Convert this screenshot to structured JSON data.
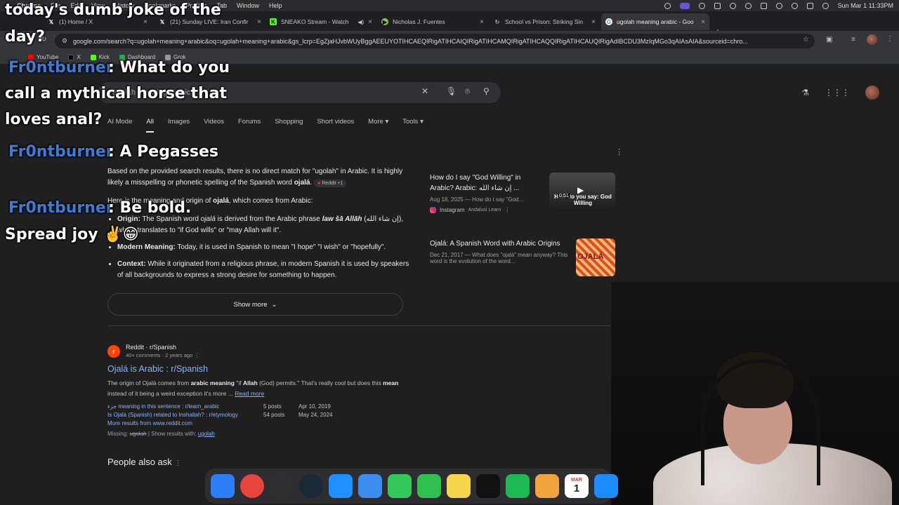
{
  "menubar": {
    "items": [
      "Chrome",
      "File",
      "Edit",
      "View",
      "History",
      "Bookmarks",
      "Profiles",
      "Tab",
      "Window",
      "Help"
    ],
    "clock": "Sun Mar 1  11:33PM"
  },
  "tabs": [
    {
      "title": "(1) Home / X",
      "icon": "x-logo-icon",
      "color": "#000000"
    },
    {
      "title": "(21) Sunday LIVE: Iran Confir",
      "icon": "x-logo-icon",
      "color": "#000000"
    },
    {
      "title": "SNEAKO Stream - Watch",
      "icon": "kick-logo-icon",
      "color": "#53fc18"
    },
    {
      "title": "Nicholas J. Fuentes",
      "icon": "rumble-logo-icon",
      "color": "#85c742"
    },
    {
      "title": "School vs Prison: Striking Sin",
      "icon": "refresh-icon",
      "color": "#aaaaaa"
    },
    {
      "title": "ugolah meaning arabic - Goo",
      "icon": "google-icon",
      "color": "#dddddd"
    }
  ],
  "address_url": "google.com/search?q=ugolah+meaning+arabic&oq=ugolah+meaning+arabic&gs_lcrp=EgZjaHJvbWUyBggAEEUYOTIHCAEQIRigATIHCAIQIRigATIHCAMQIRigATIHCAQQIRigATIHCAUQIRigAdIBCDU3MzIqMGo3qAIAsAIA&sourceid=chro...",
  "bookmarks": [
    {
      "label": "YouTube",
      "color": "#ff0000"
    },
    {
      "label": "X",
      "color": "#000000"
    },
    {
      "label": "Kick",
      "color": "#53fc18"
    },
    {
      "label": "Dashboard",
      "color": "#2da44e"
    },
    {
      "label": "Grok",
      "color": "#999999"
    }
  ],
  "search": {
    "query": "ugolah meaning arabic",
    "clear_icon": "close-icon",
    "mic_icon": "mic-icon",
    "lens_icon": "camera-icon",
    "search_icon": "search-icon"
  },
  "result_tabs": [
    "AI Mode",
    "All",
    "Images",
    "Videos",
    "Forums",
    "Shopping",
    "Short videos",
    "More",
    "Tools"
  ],
  "ai_overview": {
    "para1_a": "Based on the provided search results, there is no direct match for \"ugolah\" in Arabic. It is highly likely a misspelling or phonetic spelling of the Spanish word ",
    "para1_word": "ojalá",
    "para1_end": ".",
    "source_chip": "Reddit +1",
    "para2_a": "Here is the meaning and origin of ",
    "para2_word": "ojalá",
    "para2_b": ", which comes from Arabic:",
    "bullets": [
      {
        "label": "Origin:",
        "text_a": " The Spanish word ",
        "word": "ojalá",
        "text_b": " is derived from the Arabic phrase ",
        "phrase": "law šā Allāh",
        "text_c": " (إن شاء الله), which translates to \"if God wills\" or \"may Allah will it\"."
      },
      {
        "label": "Modern Meaning:",
        "text": " Today, it is used in Spanish to mean \"I hope\" \"I wish\" or \"hopefully\"."
      },
      {
        "label": "Context:",
        "text": " While it originated from a religious phrase, in modern Spanish it is used by speakers of all backgrounds to express a strong desire for something to happen."
      }
    ],
    "show_more": "Show more"
  },
  "video_cards": [
    {
      "title": "How do I say \"God Willing\" in Arabic? Arabic: إن شاء الله ...",
      "meta": "Aug 18, 2025 — How do I say \"God...",
      "source": "Instagram",
      "source_sub": "Andalusi Learn",
      "thumb_text": "How do you say: God Willing",
      "duration": "0:51"
    },
    {
      "title": "Ojalá: A Spanish Word with Arabic Origins",
      "meta": "Dec 21, 2017 — What does \"ojalá\" mean anyway? This word is the evolution of the word...",
      "source": "",
      "source_sub": "",
      "thumb_text": "OJALÁ",
      "duration": ""
    }
  ],
  "reddit_result": {
    "site": "Reddit · r/Spanish",
    "sub": "40+ comments · 2 years ago",
    "title": "Ojalá is Arabic : r/Spanish",
    "snippet_a": "The origin of Ojalá comes from ",
    "snippet_b1": "arabic meaning",
    "snippet_c": " \"if ",
    "snippet_b2": "Allah",
    "snippet_d": " (God) permits.\" That's really cool but does this ",
    "snippet_b3": "mean",
    "snippet_e": " instead of it being a weird exception it's more ...",
    "read_more": "Read more",
    "subresults": [
      {
        "title": "جزء meaning in this sentence : r/learn_arabic",
        "posts": "5 posts",
        "date": "Apr 10, 2019"
      },
      {
        "title": "Is Ojalá (Spanish) related to Inshallah? : r/etymology",
        "posts": "54 posts",
        "date": "May 24, 2024"
      }
    ],
    "more_results": "More results from www.reddit.com",
    "missing_label": "Missing: ",
    "missing_word": "ugolah",
    "show_with": " | Show results with: ",
    "show_with_link": "ugolah"
  },
  "people_also_ask": "People also ask",
  "overlay": {
    "heading_1": "today's dumb joke of the",
    "heading_2": "day?",
    "chat": [
      {
        "name": "Fr0ntburner",
        "lines": [
          ": What do you",
          "call a mythical horse that",
          "loves anal?"
        ]
      },
      {
        "name": "Fr0ntburner",
        "lines": [
          ": A Pegasses"
        ]
      },
      {
        "name": "Fr0ntburner",
        "lines": [
          ": Be bold.",
          "Spread joy ✌️😁"
        ]
      }
    ]
  },
  "dock": [
    {
      "name": "finder",
      "color": "#2d7ff9"
    },
    {
      "name": "chrome",
      "color": "#e8453c"
    },
    {
      "name": "obs",
      "color": "#302e31"
    },
    {
      "name": "steam",
      "color": "#1b2838"
    },
    {
      "name": "safari",
      "color": "#1e90ff"
    },
    {
      "name": "mail",
      "color": "#3b8ef0"
    },
    {
      "name": "messages",
      "color": "#34c759"
    },
    {
      "name": "facetime",
      "color": "#2fc04f"
    },
    {
      "name": "notes",
      "color": "#f7d54a"
    },
    {
      "name": "capcut",
      "color": "#111111"
    },
    {
      "name": "spotify",
      "color": "#1db954"
    },
    {
      "name": "photos",
      "color": "#f1a33c"
    },
    {
      "name": "calendar",
      "color": "#ffffff"
    },
    {
      "name": "app-store",
      "color": "#1a8cff"
    }
  ],
  "calendar_day": "1",
  "calendar_month": "MAR"
}
